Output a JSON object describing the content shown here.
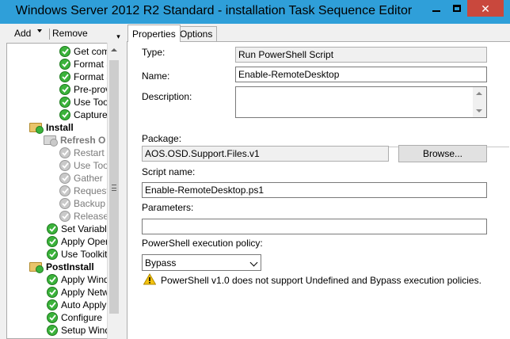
{
  "window": {
    "title": "Windows Server 2012 R2 Standard - installation Task Sequence Editor",
    "close_glyph": "✕"
  },
  "toolbar": {
    "add_label": "Add",
    "remove_label": "Remove",
    "more_glyph": "▾"
  },
  "tree": {
    "items": [
      {
        "label": "Get com",
        "kind": "step",
        "state": "enabled"
      },
      {
        "label": "Format a",
        "kind": "step",
        "state": "enabled"
      },
      {
        "label": "Format a",
        "kind": "step",
        "state": "enabled"
      },
      {
        "label": "Pre-prov",
        "kind": "step",
        "state": "enabled"
      },
      {
        "label": "Use Too",
        "kind": "step",
        "state": "enabled"
      },
      {
        "label": "Capture",
        "kind": "step",
        "state": "enabled"
      },
      {
        "label": "Install",
        "kind": "group",
        "state": "enabled"
      },
      {
        "label": "Refresh O",
        "kind": "group",
        "state": "disabled"
      },
      {
        "label": "Restart t",
        "kind": "step",
        "state": "disabled"
      },
      {
        "label": "Use Too",
        "kind": "step",
        "state": "disabled"
      },
      {
        "label": "Gather",
        "kind": "step",
        "state": "disabled"
      },
      {
        "label": "Request",
        "kind": "step",
        "state": "disabled"
      },
      {
        "label": "Backup",
        "kind": "step",
        "state": "disabled"
      },
      {
        "label": "Release",
        "kind": "step",
        "state": "disabled"
      },
      {
        "label": "Set Variable",
        "kind": "step",
        "state": "enabled"
      },
      {
        "label": "Apply Opera",
        "kind": "step",
        "state": "enabled"
      },
      {
        "label": "Use Toolkit",
        "kind": "step",
        "state": "enabled"
      },
      {
        "label": "PostInstall",
        "kind": "group",
        "state": "enabled"
      },
      {
        "label": "Apply Windo",
        "kind": "step",
        "state": "enabled"
      },
      {
        "label": "Apply Netwo",
        "kind": "step",
        "state": "enabled"
      },
      {
        "label": "Auto Apply D",
        "kind": "step",
        "state": "enabled"
      },
      {
        "label": "Configure",
        "kind": "step",
        "state": "enabled"
      },
      {
        "label": "Setup Windo",
        "kind": "step",
        "state": "enabled"
      }
    ]
  },
  "tabs": {
    "properties": "Properties",
    "options": "Options"
  },
  "properties": {
    "type_label": "Type:",
    "type_value": "Run PowerShell Script",
    "name_label": "Name:",
    "name_value": "Enable-RemoteDesktop",
    "description_label": "Description:",
    "description_value": "",
    "package_label": "Package:",
    "package_value": "AOS.OSD.Support.Files.v1",
    "browse_label": "Browse...",
    "script_name_label": "Script name:",
    "script_name_value": "Enable-RemoteDesktop.ps1",
    "parameters_label": "Parameters:",
    "parameters_value": "",
    "policy_label": "PowerShell execution policy:",
    "policy_value": "Bypass",
    "warning_text": "PowerShell v1.0 does not support Undefined and Bypass execution policies."
  },
  "colors": {
    "titlebar": "#2f9fd9",
    "close_button": "#c9483d",
    "enabled_check": "#3bb33b",
    "disabled_check": "#c9c9c9",
    "warning": "#f4c20d"
  },
  "icons": {
    "enabled_step": "green-check-icon",
    "disabled_step": "gray-check-icon",
    "group": "folder-icon",
    "warning": "warning-icon"
  }
}
